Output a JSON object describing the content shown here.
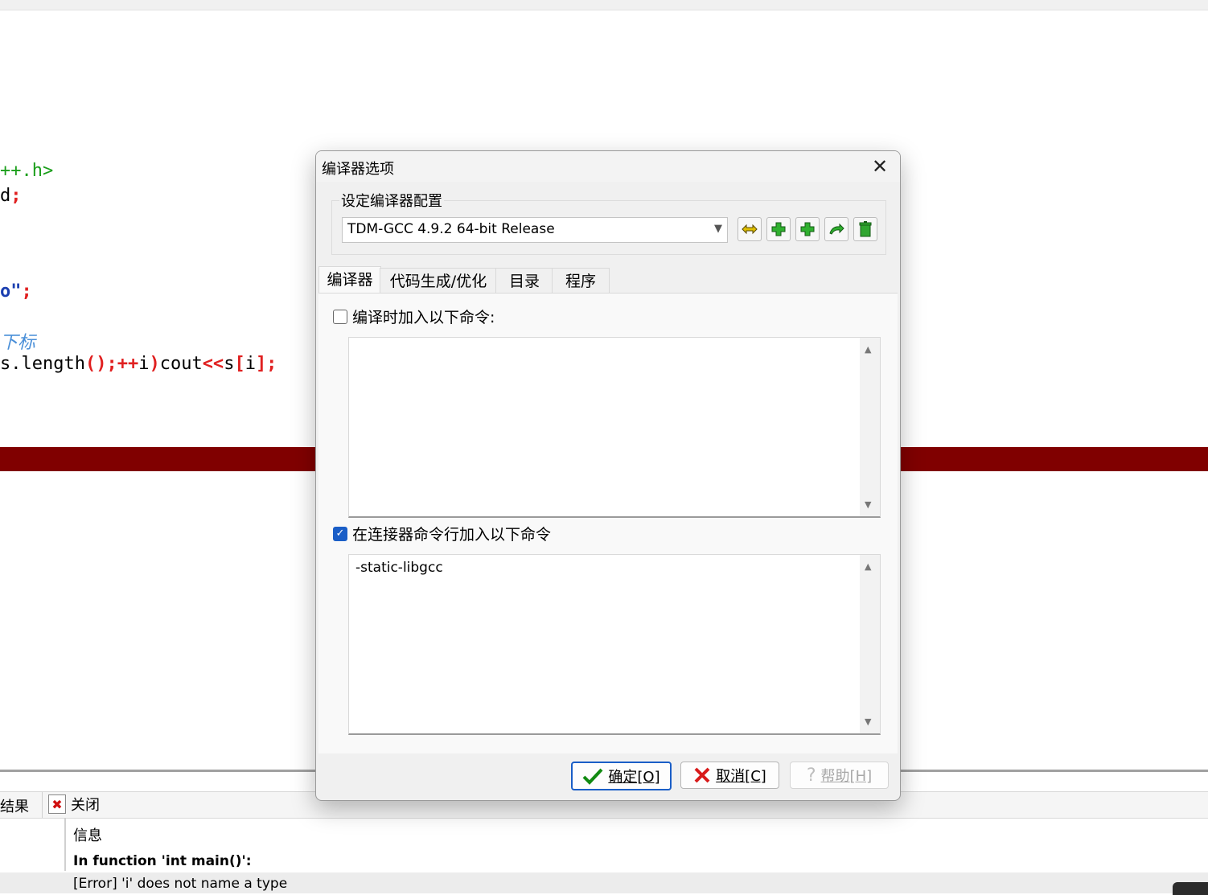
{
  "editor": {
    "lines": [
      {
        "parts": [
          {
            "t": "++.h>",
            "c": "inc"
          }
        ]
      },
      {
        "parts": [
          {
            "t": "d",
            "c": "ink"
          },
          {
            "t": ";",
            "c": "red"
          }
        ]
      },
      {
        "parts": [
          {
            "t": "o\"",
            "c": "blue"
          },
          {
            "t": ";",
            "c": "red"
          }
        ]
      },
      {
        "parts": [
          {
            "t": "下标",
            "c": "cmt"
          }
        ]
      },
      {
        "parts": [
          {
            "t": "s.length",
            "c": "ink"
          },
          {
            "t": "();++",
            "c": "red"
          },
          {
            "t": "i",
            "c": "ink"
          },
          {
            "t": ")",
            "c": "red"
          },
          {
            "t": "cout",
            "c": "ink"
          },
          {
            "t": "<<",
            "c": "red"
          },
          {
            "t": "s",
            "c": "ink"
          },
          {
            "t": "[",
            "c": "red"
          },
          {
            "t": "i",
            "c": "ink"
          },
          {
            "t": "];",
            "c": "red"
          }
        ]
      }
    ],
    "error_line_color": "#800000"
  },
  "bottom_panel": {
    "tab_partial": "结果",
    "close_label": "关闭",
    "column_header": "信息",
    "messages": [
      "In function 'int main()':",
      "[Error] 'i' does not name a type"
    ]
  },
  "dialog": {
    "title": "编译器选项",
    "group_label": "设定编译器配置",
    "compiler_set": "TDM-GCC 4.9.2 64-bit Release",
    "toolbar_icons": [
      "find-compilers-icon",
      "add-plus-icon",
      "add-plus-icon",
      "rename-icon",
      "delete-trash-icon"
    ],
    "tabs": [
      "编译器",
      "代码生成/优化",
      "目录",
      "程序"
    ],
    "active_tab": "编译器",
    "compile_option": {
      "label": "编译时加入以下命令:",
      "checked": false,
      "value": ""
    },
    "linker_option": {
      "label": "在连接器命令行加入以下命令",
      "checked": true,
      "value": "-static-libgcc"
    },
    "buttons": {
      "ok": "确定[O]",
      "cancel": "取消[C]",
      "help": "帮助[H]"
    }
  }
}
